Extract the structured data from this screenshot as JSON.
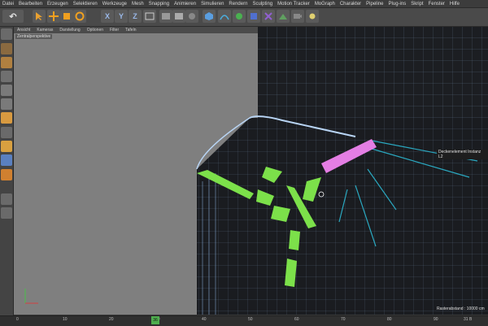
{
  "menu": [
    "Datei",
    "Bearbeiten",
    "Erzeugen",
    "Selektieren",
    "Werkzeuge",
    "Mesh",
    "Snapping",
    "Animieren",
    "Simulieren",
    "Rendern",
    "Sculpting",
    "Motion Tracker",
    "MoGraph",
    "Charakter",
    "Pipeline",
    "Plug-ins",
    "Skript",
    "Fenster",
    "Hilfe"
  ],
  "toolbar": {
    "undo_label": "↶",
    "x_label": "X",
    "y_label": "Y",
    "z_label": "Z"
  },
  "viewport": {
    "menu": [
      "Ansicht",
      "Kameras",
      "Darstellung",
      "Optionen",
      "Filter",
      "Tafeln"
    ],
    "camera_label": "Zentralperspektive",
    "hover_label": "Deckenelement Instanz L2",
    "grid_label": "Rasterabstand : 10000 cm"
  },
  "timeline": {
    "ticks": [
      "0",
      "10",
      "20",
      "30",
      "40",
      "50",
      "60",
      "70",
      "80",
      "90"
    ],
    "current_frame": "36",
    "end_label": "31 B"
  },
  "colors": {
    "viewport_bg": "#7f7f7f",
    "mesh_fill": "#1c1e22",
    "wire": "#8fb8e8",
    "green_selection": "#7ce04a",
    "pink_selection": "#e47ee4",
    "cyan_edges": "#2aa8c0"
  }
}
